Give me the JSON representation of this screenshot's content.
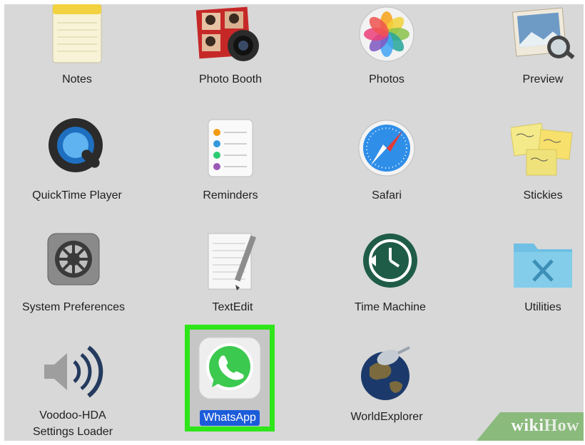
{
  "apps": [
    {
      "name": "Notes"
    },
    {
      "name": "Photo Booth"
    },
    {
      "name": "Photos"
    },
    {
      "name": "Preview"
    },
    {
      "name": "QuickTime Player"
    },
    {
      "name": "Reminders"
    },
    {
      "name": "Safari"
    },
    {
      "name": "Stickies"
    },
    {
      "name": "System Preferences"
    },
    {
      "name": "TextEdit"
    },
    {
      "name": "Time Machine"
    },
    {
      "name": "Utilities"
    },
    {
      "name_line1": "Voodoo-HDA",
      "name_line2": "Settings Loader"
    },
    {
      "name": "WhatsApp",
      "selected": true
    },
    {
      "name": "WorldExplorer"
    }
  ],
  "watermark": {
    "wiki": "wiki",
    "how": "How"
  },
  "colors": {
    "highlight": "#2ee51a",
    "selection_label": "#1c5cdb",
    "background": "#d8d8d8"
  }
}
